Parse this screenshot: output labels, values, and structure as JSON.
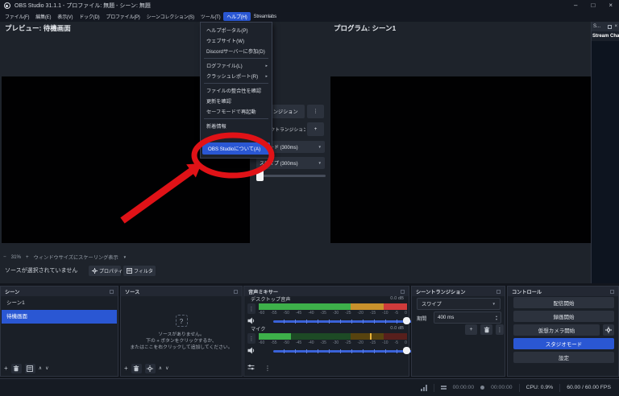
{
  "window": {
    "title": "OBS Studio 31.1.1 - プロファイル: 無題 - シーン: 無題",
    "minimize": "–",
    "maximize": "□",
    "close": "×"
  },
  "menu_bar": {
    "items": [
      {
        "label": "ファイル(F)"
      },
      {
        "label": "編集(E)"
      },
      {
        "label": "表示(V)"
      },
      {
        "label": "ドック(D)"
      },
      {
        "label": "プロファイル(P)"
      },
      {
        "label": "シーンコレクション(S)"
      },
      {
        "label": "ツール(T)"
      },
      {
        "label": "ヘルプ(H)",
        "active": true
      },
      {
        "label": "Streamlabs"
      }
    ]
  },
  "help_menu": {
    "items": [
      {
        "label": "ヘルプポータル(P)"
      },
      {
        "label": "ウェブサイト(W)"
      },
      {
        "label": "Discordサーバーに参加(D)",
        "sep_after": true
      },
      {
        "label": "ログファイル(L)",
        "submenu": true
      },
      {
        "label": "クラッシュレポート(R)",
        "submenu": true,
        "sep_after": true
      },
      {
        "label": "ファイルの整合性を確認"
      },
      {
        "label": "更新を確認"
      },
      {
        "label": "セーフモードで再起動",
        "sep_after": true
      },
      {
        "label": "新着情報"
      },
      {
        "label": "",
        "obscured": true
      },
      {
        "label": "OBS Studioについて(A)",
        "active": true
      }
    ]
  },
  "preview": {
    "label": "プレビュー: 待機画面",
    "zoom_out": "−",
    "zoom_level": "31%",
    "zoom_in": "+",
    "scale_mode": "ウィンドウサイズにスケーリング表示"
  },
  "program": {
    "label": "プログラム: シーン1"
  },
  "studio_controls": {
    "transition_button": "トランジション",
    "quick_transitions_label": "クイックトランジション",
    "quick_transitions": [
      {
        "label": "フェード (300ms)"
      },
      {
        "label": "スワイプ (300ms)"
      }
    ]
  },
  "source_bar": {
    "message": "ソースが選択されていません",
    "properties": "プロパティ",
    "filters": "フィルタ"
  },
  "stream_chat": {
    "dock_title": "S...",
    "close": "×",
    "title": "Stream Chat"
  },
  "docks": {
    "scenes": {
      "title": "シーン",
      "items": [
        {
          "label": "シーン1"
        },
        {
          "label": "待機画面",
          "selected": true
        }
      ]
    },
    "sources": {
      "title": "ソース",
      "empty_icon": "?",
      "empty_lines": [
        "ソースがありません。",
        "下の + ボタンをクリックするか、",
        "またはここを右クリックして追加してください。"
      ]
    },
    "mixer": {
      "title": "音声ミキサー",
      "ticks": [
        "-60",
        "-55",
        "-50",
        "-45",
        "-40",
        "-35",
        "-30",
        "-25",
        "-20",
        "-15",
        "-10",
        "-5",
        "0"
      ],
      "channels": [
        {
          "name": "デスクトップ音声",
          "db_label": "0.0 dB",
          "level_db": 0,
          "volume": 1
        },
        {
          "name": "マイク",
          "db_label": "0.0 dB",
          "level_db": -47,
          "peak_db": -15,
          "volume": 1
        }
      ]
    },
    "transitions": {
      "title": "シーントランジション",
      "current": "スワイプ",
      "duration_label": "期間",
      "duration_value": "400 ms"
    },
    "controls": {
      "title": "コントロール",
      "buttons": [
        {
          "label": "配信開始"
        },
        {
          "label": "録画開始"
        },
        {
          "label": "仮想カメラ開始",
          "gear": true
        },
        {
          "label": "スタジオモード",
          "active": true
        },
        {
          "label": "設定"
        }
      ]
    }
  },
  "status_bar": {
    "stream_time": "00:00:00",
    "rec_time": "00:00:00",
    "cpu": "CPU: 0.9%",
    "fps": "60.00 / 60.00 FPS"
  },
  "icons": {
    "add": "+",
    "up": "∧",
    "down": "∨",
    "more": "⋮",
    "dropdown": "▼",
    "submenu": "▸"
  },
  "colors": {
    "accent": "#2a57d3",
    "annotation": "#e01217",
    "meter_green": "#3db04a",
    "meter_orange": "#c9912c",
    "meter_red": "#cf3b3b"
  }
}
